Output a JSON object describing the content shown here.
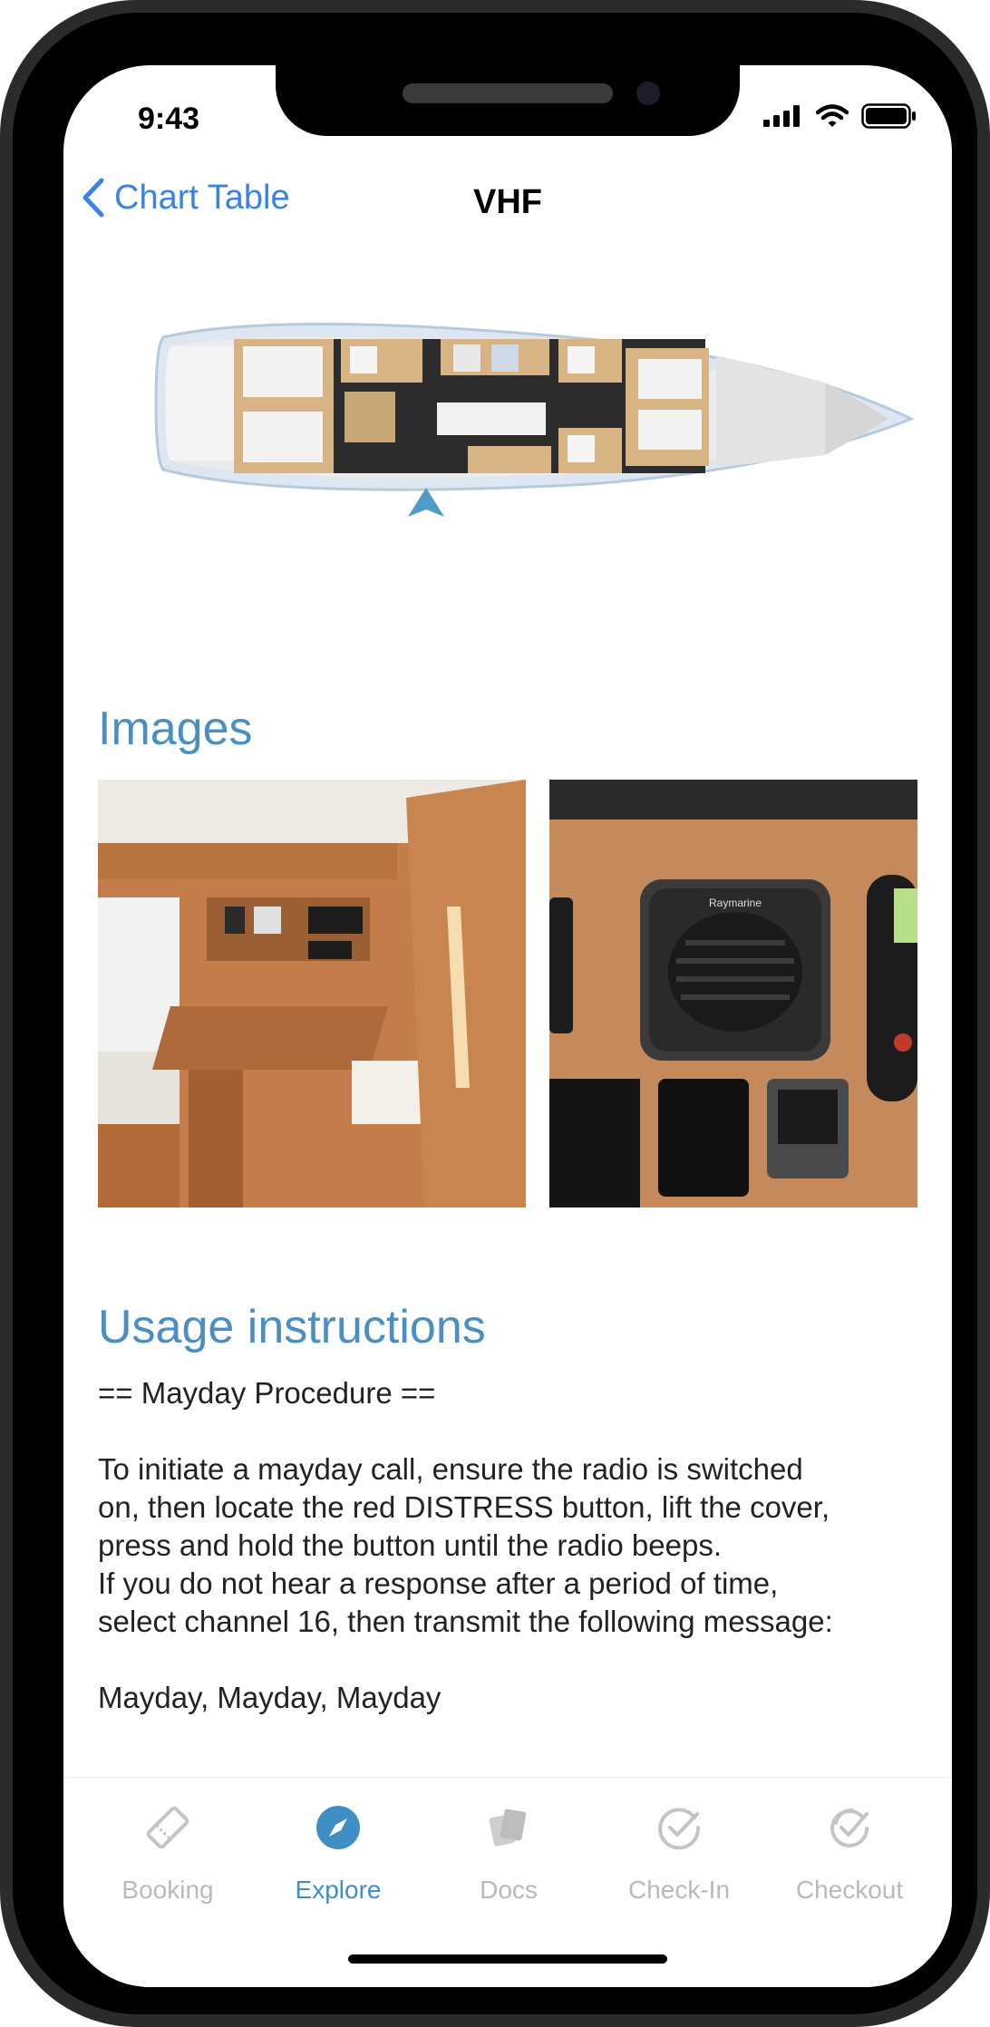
{
  "status": {
    "time": "9:43"
  },
  "nav": {
    "back_label": "Chart Table",
    "title": "VHF"
  },
  "sections": {
    "images_title": "Images",
    "usage_title": "Usage instructions"
  },
  "usage": {
    "heading_line": "== Mayday Procedure ==",
    "lines": [
      "To initiate a mayday call, ensure the radio is switched",
      "on, then locate the red DISTRESS button, lift the cover,",
      "press and hold the button until the radio beeps.",
      "If you do not hear a response after a period of time,",
      "select channel 16, then transmit the following message:"
    ],
    "closing_line": "Mayday, Mayday, Mayday"
  },
  "images": {
    "radio_brand": "Raymarine"
  },
  "tabs": [
    {
      "label": "Booking",
      "icon": "ticket-icon",
      "active": false
    },
    {
      "label": "Explore",
      "icon": "compass-icon",
      "active": true
    },
    {
      "label": "Docs",
      "icon": "documents-icon",
      "active": false
    },
    {
      "label": "Check-In",
      "icon": "checkmark-circle-icon",
      "active": false
    },
    {
      "label": "Checkout",
      "icon": "double-checkmark-icon",
      "active": false
    }
  ],
  "colors": {
    "accent": "#3a82e6",
    "section_title": "#4a8fc4",
    "tab_active": "#3f8ec4",
    "tab_inactive": "#b9b9b9"
  }
}
